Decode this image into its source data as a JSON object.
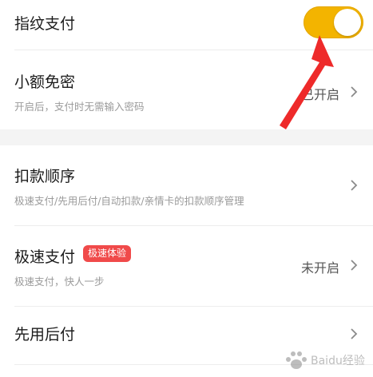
{
  "fingerprint": {
    "title": "指纹支付",
    "toggle_on": true,
    "toggle_color": "#f3b400"
  },
  "small_amount": {
    "title": "小额免密",
    "subtitle": "开启后，支付时无需输入密码",
    "status": "已开启"
  },
  "deduction_order": {
    "title": "扣款顺序",
    "subtitle": "极速支付/先用后付/自动扣款/亲情卡的扣款顺序管理"
  },
  "express_pay": {
    "title": "极速支付",
    "badge": "极速体验",
    "badge_color": "#f04a4a",
    "subtitle": "极速支付，快人一步",
    "status": "未开启"
  },
  "pay_later": {
    "title": "先用后付"
  },
  "annotation": {
    "arrow_color": "#ee2a2a"
  },
  "watermark": {
    "text": "Baidu经验"
  },
  "icons": {
    "chevron": "chevron-right-icon"
  }
}
